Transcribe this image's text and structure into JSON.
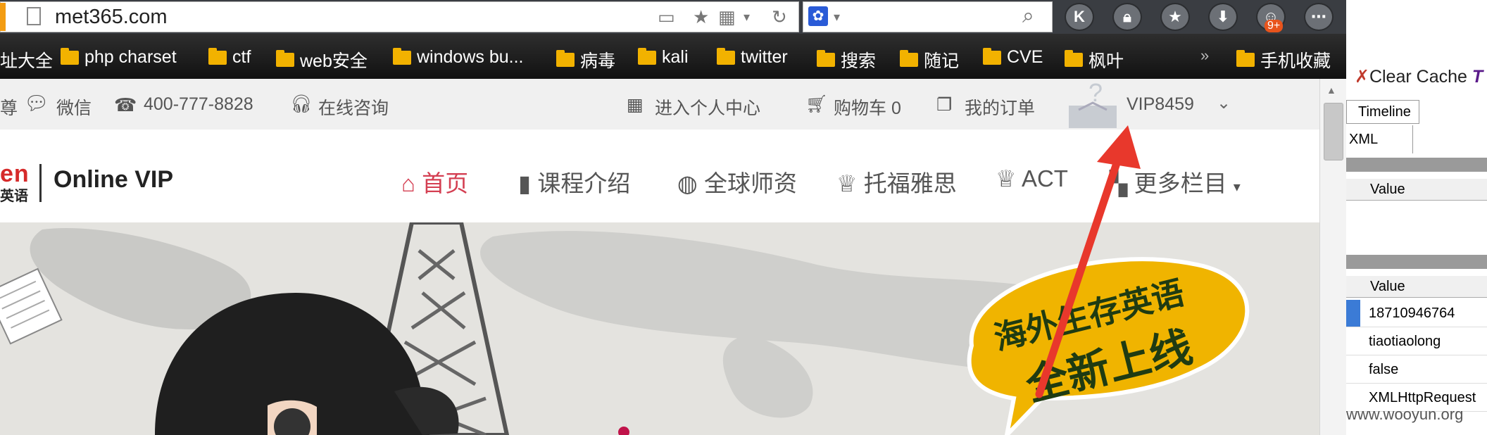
{
  "browser": {
    "url": "met365.com",
    "notification_badge": "9+",
    "toolbar_buttons": [
      "K",
      "lock",
      "star",
      "download",
      "game",
      "more"
    ]
  },
  "bookmarks": [
    {
      "label": "址大全",
      "x_hint": "start"
    },
    {
      "label": "php charset"
    },
    {
      "label": "ctf"
    },
    {
      "label": "web安全"
    },
    {
      "label": "windows bu..."
    },
    {
      "label": "病毒"
    },
    {
      "label": "kali"
    },
    {
      "label": "twitter"
    },
    {
      "label": "搜索"
    },
    {
      "label": "随记"
    },
    {
      "label": "CVE"
    },
    {
      "label": "枫叶"
    }
  ],
  "bookmarks_more": "»",
  "bookmarks_mobile": "手机收藏",
  "topstrip": {
    "left_partial": "尊",
    "wechat": "微信",
    "phone": "400-777-8828",
    "consult": "在线咨询",
    "personal_center": "进入个人中心",
    "cart": "购物车 0",
    "orders": "我的订单",
    "user": "VIP8459"
  },
  "logo": {
    "en_partial": "en",
    "cn_partial": "英语",
    "product": "Online VIP"
  },
  "nav": [
    {
      "label": "首页",
      "icon": "home-icon",
      "active": true
    },
    {
      "label": "课程介绍",
      "icon": "file-icon",
      "active": false
    },
    {
      "label": "全球师资",
      "icon": "globe-icon",
      "active": false
    },
    {
      "label": "托福雅思",
      "icon": "trophy-icon",
      "active": false
    },
    {
      "label": "ACT",
      "icon": "trophy-icon",
      "active": false
    },
    {
      "label": "更多栏目",
      "icon": "grid-icon",
      "active": false
    }
  ],
  "banner": {
    "bubble_line1": "海外生存英语",
    "bubble_line2": "全新上线"
  },
  "devtools": {
    "clear_cache": "Clear Cache",
    "tab_timeline": "Timeline",
    "tab_xml": "XML",
    "value_header_1": "Value",
    "value_header_2": "Value",
    "rows": [
      "18710946764",
      "tiaotiaolong",
      "false",
      "XMLHttpRequest"
    ]
  },
  "watermark": "www.wooyun.org",
  "colors": {
    "nav_active": "#d43f52",
    "bookmark_folder": "#f2b200",
    "bubble": "#f0b400",
    "arrow": "#e8382c"
  }
}
